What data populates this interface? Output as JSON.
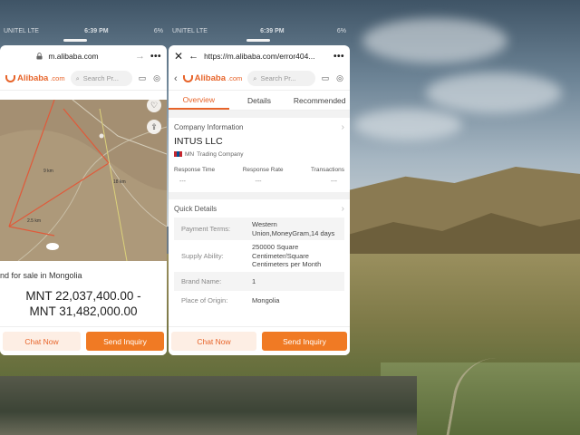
{
  "status_left": {
    "carrier": "UNITEL LTE",
    "time": "6:39 PM",
    "battery": "6%"
  },
  "status_right": {
    "carrier": "UNITEL LTE",
    "time": "6:39 PM",
    "battery": "6%"
  },
  "left_window": {
    "url": "m.alibaba.com",
    "logo_text": "Alibaba",
    "logo_suffix": ".com",
    "search_placeholder": "Search Pr...",
    "product_title": "nd for sale in Mongolia",
    "price_line1": "MNT 22,037,400.00 -",
    "price_line2": "MNT 31,482,000.00",
    "chat_button": "Chat Now",
    "inquiry_button": "Send Inquiry",
    "map_labels": [
      "9 km",
      "2.5 km",
      "18 km"
    ]
  },
  "right_window": {
    "url": "https://m.alibaba.com/error404...",
    "logo_text": "Alibaba",
    "logo_suffix": ".com",
    "search_placeholder": "Search Pr...",
    "tabs": [
      "Overview",
      "Details",
      "Recommended"
    ],
    "active_tab": "Overview",
    "company_section_title": "Company Information",
    "company_name": "INTUS LLC",
    "company_country": "MN",
    "company_type": "Trading Company",
    "stats_headers": [
      "Response Time",
      "Response Rate",
      "Transactions"
    ],
    "stats_values": [
      "---",
      "---",
      "---"
    ],
    "quick_details_title": "Quick Details",
    "details": [
      {
        "label": "Payment Terms:",
        "value": "Western Union,MoneyGram,14 days"
      },
      {
        "label": "Supply Ability:",
        "value": "250000 Square Centimeter/Square Centimeters per Month"
      },
      {
        "label": "Brand Name:",
        "value": "1"
      },
      {
        "label": "Place of Origin:",
        "value": "Mongolia"
      }
    ],
    "chat_button": "Chat Now",
    "inquiry_button": "Send Inquiry"
  },
  "colors": {
    "accent": "#e7642a",
    "inquiry_bg": "#f07a24",
    "chat_bg": "#fdeee4"
  },
  "icons": [
    "lock-icon",
    "back-icon",
    "forward-icon",
    "more-icon",
    "close-icon",
    "search-icon",
    "message-icon",
    "account-icon",
    "heart-icon",
    "share-icon",
    "chevron-right-icon",
    "flag-icon"
  ]
}
